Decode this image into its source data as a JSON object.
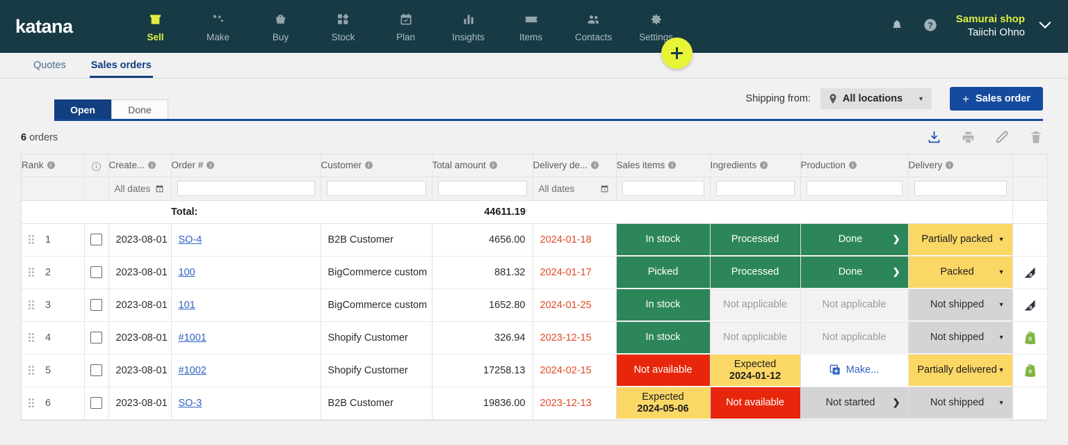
{
  "brand": {
    "logo": "katana",
    "accent": "#dfee3f",
    "navbar_bg": "#173a45",
    "primary": "#154b9e"
  },
  "topnav": {
    "items": [
      {
        "label": "Sell",
        "icon": "store-icon",
        "active": true
      },
      {
        "label": "Make",
        "icon": "hammer-icon",
        "active": false
      },
      {
        "label": "Buy",
        "icon": "basket-icon",
        "active": false
      },
      {
        "label": "Stock",
        "icon": "blocks-icon",
        "active": false
      },
      {
        "label": "Plan",
        "icon": "calendar-check-icon",
        "active": false
      },
      {
        "label": "Insights",
        "icon": "bar-chart-icon",
        "active": false
      },
      {
        "label": "Items",
        "icon": "tag-star-icon",
        "active": false
      },
      {
        "label": "Contacts",
        "icon": "people-icon",
        "active": false
      },
      {
        "label": "Settings",
        "icon": "gear-icon",
        "active": false
      }
    ],
    "add_button": "+",
    "notifications_icon": "bell-icon",
    "help_icon": "question-circle-icon",
    "account": {
      "shop": "Samurai shop",
      "user": "Taiichi Ohno"
    }
  },
  "subtabs": [
    {
      "label": "Quotes",
      "active": false
    },
    {
      "label": "Sales orders",
      "active": true
    }
  ],
  "toolbar": {
    "segments": [
      {
        "label": "Open",
        "active": true
      },
      {
        "label": "Done",
        "active": false
      }
    ],
    "shipping_from_label": "Shipping from:",
    "location_value": "All locations",
    "new_order_button": "Sales order",
    "count_text_value": "6",
    "count_text_suffix": " orders",
    "actions": [
      {
        "name": "download-icon",
        "enabled": true
      },
      {
        "name": "print-icon",
        "enabled": false
      },
      {
        "name": "edit-pencil-icon",
        "enabled": false
      },
      {
        "name": "delete-trash-icon",
        "enabled": false
      }
    ]
  },
  "table": {
    "columns": [
      {
        "key": "rank",
        "label": "Rank",
        "info": true
      },
      {
        "key": "check",
        "label": "",
        "info": "circle"
      },
      {
        "key": "created",
        "label": "Create...",
        "info": true
      },
      {
        "key": "order",
        "label": "Order #",
        "info": true
      },
      {
        "key": "customer",
        "label": "Customer",
        "info": true
      },
      {
        "key": "total",
        "label": "Total amount",
        "info": true
      },
      {
        "key": "delivery_deadline",
        "label": "Delivery de...",
        "info": true
      },
      {
        "key": "sales_items",
        "label": "Sales items",
        "info": true
      },
      {
        "key": "ingredients",
        "label": "Ingredients",
        "info": true
      },
      {
        "key": "production",
        "label": "Production",
        "info": true
      },
      {
        "key": "delivery",
        "label": "Delivery",
        "info": true
      },
      {
        "key": "source",
        "label": "",
        "info": false
      }
    ],
    "filters": {
      "created_placeholder": "All dates",
      "delivery_placeholder": "All dates"
    },
    "total_label": "Total:",
    "total_amount": "44611.19",
    "rows": [
      {
        "rank": "1",
        "created": "2023-08-01",
        "order": "SO-4",
        "customer": "B2B Customer",
        "total": "4656.00",
        "delivery_deadline": "2024-01-18",
        "sales_items": {
          "text": "In stock",
          "style": "green"
        },
        "ingredients": {
          "text": "Processed",
          "style": "green"
        },
        "production": {
          "text": "Done",
          "style": "green",
          "chevron": true
        },
        "delivery": {
          "text": "Partially packed",
          "style": "yellow",
          "caret": true
        },
        "source": ""
      },
      {
        "rank": "2",
        "created": "2023-08-01",
        "order": "100",
        "customer": "BigCommerce custom",
        "total": "881.32",
        "delivery_deadline": "2024-01-17",
        "sales_items": {
          "text": "Picked",
          "style": "green"
        },
        "ingredients": {
          "text": "Processed",
          "style": "green"
        },
        "production": {
          "text": "Done",
          "style": "green",
          "chevron": true
        },
        "delivery": {
          "text": "Packed",
          "style": "yellow",
          "caret": true
        },
        "source": "bigcommerce-icon"
      },
      {
        "rank": "3",
        "created": "2023-08-01",
        "order": "101",
        "customer": "BigCommerce custom",
        "total": "1652.80",
        "delivery_deadline": "2024-01-25",
        "sales_items": {
          "text": "In stock",
          "style": "green"
        },
        "ingredients": {
          "text": "Not applicable",
          "style": "na"
        },
        "production": {
          "text": "Not applicable",
          "style": "na"
        },
        "delivery": {
          "text": "Not shipped",
          "style": "grey",
          "caret": true
        },
        "source": "bigcommerce-icon"
      },
      {
        "rank": "4",
        "created": "2023-08-01",
        "order": "#1001",
        "customer": "Shopify Customer",
        "total": "326.94",
        "delivery_deadline": "2023-12-15",
        "sales_items": {
          "text": "In stock",
          "style": "green"
        },
        "ingredients": {
          "text": "Not applicable",
          "style": "na"
        },
        "production": {
          "text": "Not applicable",
          "style": "na"
        },
        "delivery": {
          "text": "Not shipped",
          "style": "grey",
          "caret": true
        },
        "source": "shopify-icon"
      },
      {
        "rank": "5",
        "created": "2023-08-01",
        "order": "#1002",
        "customer": "Shopify Customer",
        "total": "17258.13",
        "delivery_deadline": "2024-02-15",
        "sales_items": {
          "text": "Not available",
          "style": "red"
        },
        "ingredients": {
          "text": "Expected",
          "sub": "2024-01-12",
          "style": "yellow"
        },
        "production": {
          "text": "Make...",
          "style": "white",
          "plus": true
        },
        "delivery": {
          "text": "Partially delivered",
          "style": "yellow",
          "caret": true
        },
        "source": "shopify-icon"
      },
      {
        "rank": "6",
        "created": "2023-08-01",
        "order": "SO-3",
        "customer": "B2B Customer",
        "total": "19836.00",
        "delivery_deadline": "2023-12-13",
        "sales_items": {
          "text": "Expected",
          "sub": "2024-05-06",
          "style": "yellow"
        },
        "ingredients": {
          "text": "Not available",
          "style": "red"
        },
        "production": {
          "text": "Not started",
          "style": "grey",
          "chevron": true
        },
        "delivery": {
          "text": "Not shipped",
          "style": "grey",
          "caret": true
        },
        "source": ""
      }
    ]
  }
}
